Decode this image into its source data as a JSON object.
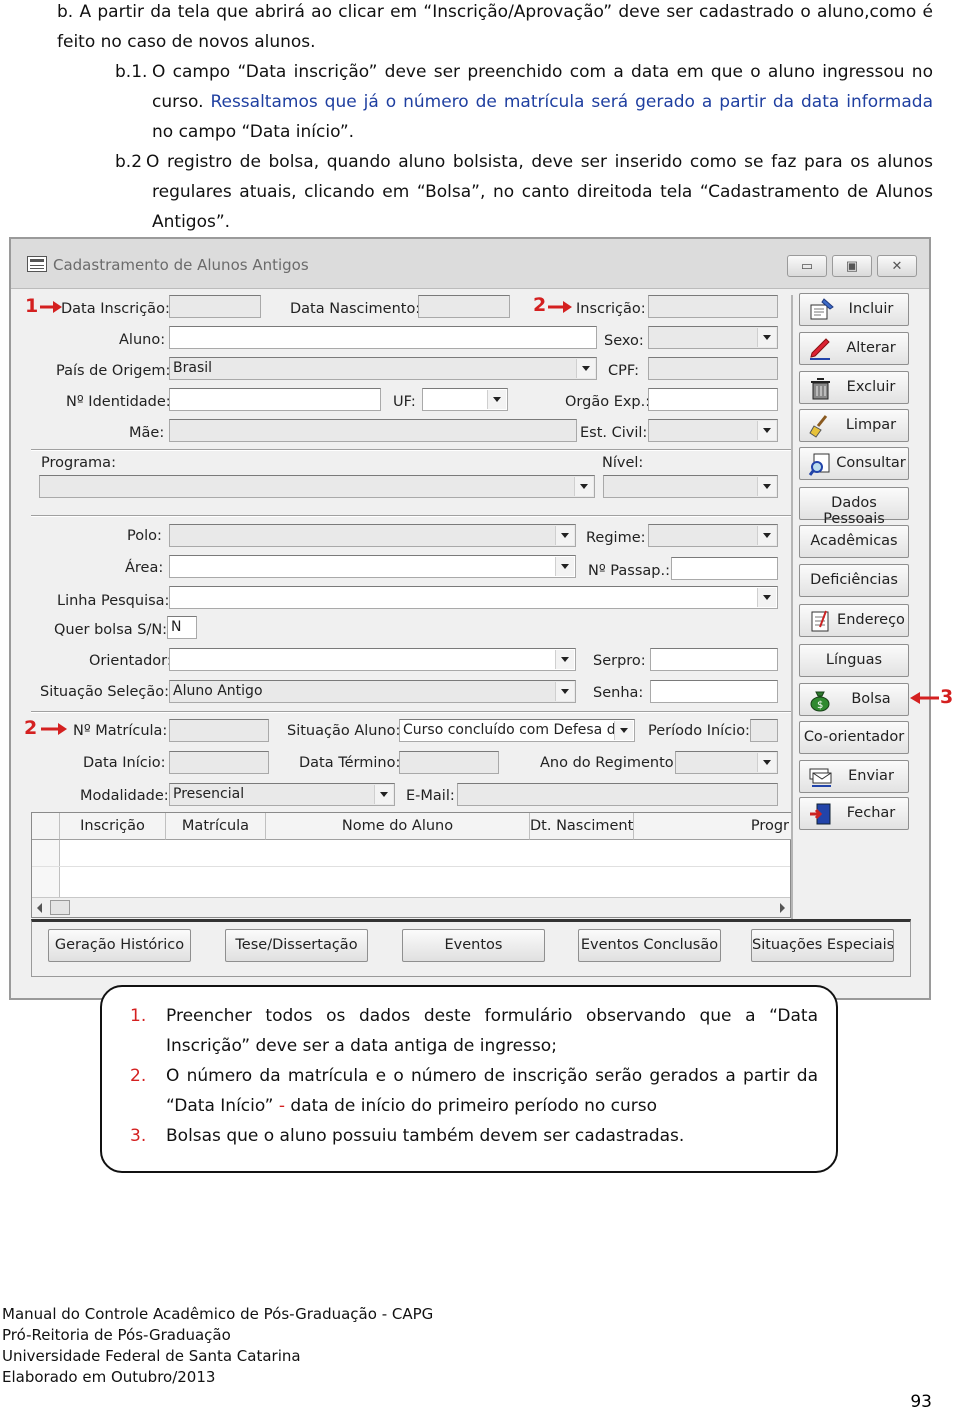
{
  "doc": {
    "b_line1": "b.  A partir da tela que abrirá ao clicar em “Inscrição/Aprovação” deve ser cadastrado o aluno,como é",
    "b_line2": "feito no caso de novos alunos.",
    "b1_label": "b.1.",
    "b1_line1": "O campo “Data inscrição” deve ser preenchido com a data em que o aluno ingressou no",
    "b1_line2a": "curso. ",
    "b1_line2b": "Ressaltamos que já o número de matrícula será gerado a partir da data informada",
    "b1_line3": "no campo “Data início”.",
    "b2_label": "b.2",
    "b2_line1": "O registro de bolsa, quando aluno bolsista, deve ser inserido como se faz para os alunos",
    "b2_line2": "regulares atuais, clicando em “Bolsa”, no canto direitoda tela “Cadastramento de Alunos",
    "b2_line3": "Antigos”."
  },
  "window": {
    "title": "Cadastramento de Alunos Antigos",
    "minimize": "▭",
    "maximize": "▣",
    "close": "✕"
  },
  "form": {
    "data_inscricao": "Data Inscrição:",
    "data_nascimento": "Data Nascimento:",
    "inscricao": "Inscrição:",
    "aluno": "Aluno:",
    "sexo": "Sexo:",
    "pais_origem": "País de Origem:",
    "pais_origem_value": "Brasil",
    "cpf": "CPF:",
    "identidade": "Nº Identidade:",
    "uf": "UF:",
    "orgao_exp": "Orgão Exp.:",
    "mae": "Mãe:",
    "est_civil": "Est. Civil:",
    "programa": "Programa:",
    "nivel": "Nível:",
    "polo": "Polo:",
    "regime": "Regime:",
    "area": "Área:",
    "passap": "Nº Passap.:",
    "linha_pesquisa": "Linha Pesquisa:",
    "quer_bolsa": "Quer bolsa S/N:",
    "quer_bolsa_value": "N",
    "orientador": "Orientador:",
    "serpro": "Serpro:",
    "situacao_selecao": "Situação Seleção:",
    "situacao_selecao_value": "Aluno Antigo",
    "senha": "Senha:",
    "matricula": "Nº Matrícula:",
    "situacao_aluno": "Situação Aluno:",
    "situacao_aluno_value": "Curso concluído com Defesa de",
    "periodo_inicio": "Período Início:",
    "data_inicio": "Data Início:",
    "data_termino": "Data Término:",
    "ano_regimento": "Ano do Regimento:",
    "modalidade": "Modalidade:",
    "modalidade_value": "Presencial",
    "email": "E-Mail:"
  },
  "side_buttons": [
    "Incluir",
    "Alterar",
    "Excluir",
    "Limpar",
    "Consultar",
    "Dados Pessoais",
    "Acadêmicas",
    "Deficiências",
    "Endereço",
    "Línguas",
    "Bolsa",
    "Co-orientador",
    "Enviar",
    "Fechar"
  ],
  "grid_columns": [
    "Inscrição",
    "Matrícula",
    "Nome do Aluno",
    "Dt. Nascimento",
    "Progr"
  ],
  "bottom_buttons": [
    "Geração Histórico",
    "Tese/Dissertação",
    "Eventos",
    "Eventos Conclusão",
    "Situações Especiais"
  ],
  "markers": {
    "m1": "1",
    "m2a": "2",
    "m2b": "2",
    "m3": "3"
  },
  "notes": [
    {
      "num": "1.",
      "line1": "Preencher todos os dados deste formulário observando que a “Data",
      "line2": "Inscrição” deve ser a data antiga de ingresso;"
    },
    {
      "num": "2.",
      "line1": "O número da matrícula e o número de inscrição serão gerados a partir da",
      "line2a": "“Data Início” ",
      "line2b": "-",
      "line2c": " data de início do primeiro período no curso"
    },
    {
      "num": "3.",
      "line1": "Bolsas que o aluno possuiu também devem ser cadastradas."
    }
  ],
  "footer": {
    "l1": "Manual do Controle Acadêmico de Pós-Graduação - CAPG",
    "l2": "Pró-Reitoria de Pós-Graduação",
    "l3": "Universidade Federal de Santa Catarina",
    "l4": "Elaborado em Outubro/2013"
  },
  "page_number": "93",
  "colors": {
    "marker": "#d42020",
    "link_blue": "#1f3fa0"
  }
}
